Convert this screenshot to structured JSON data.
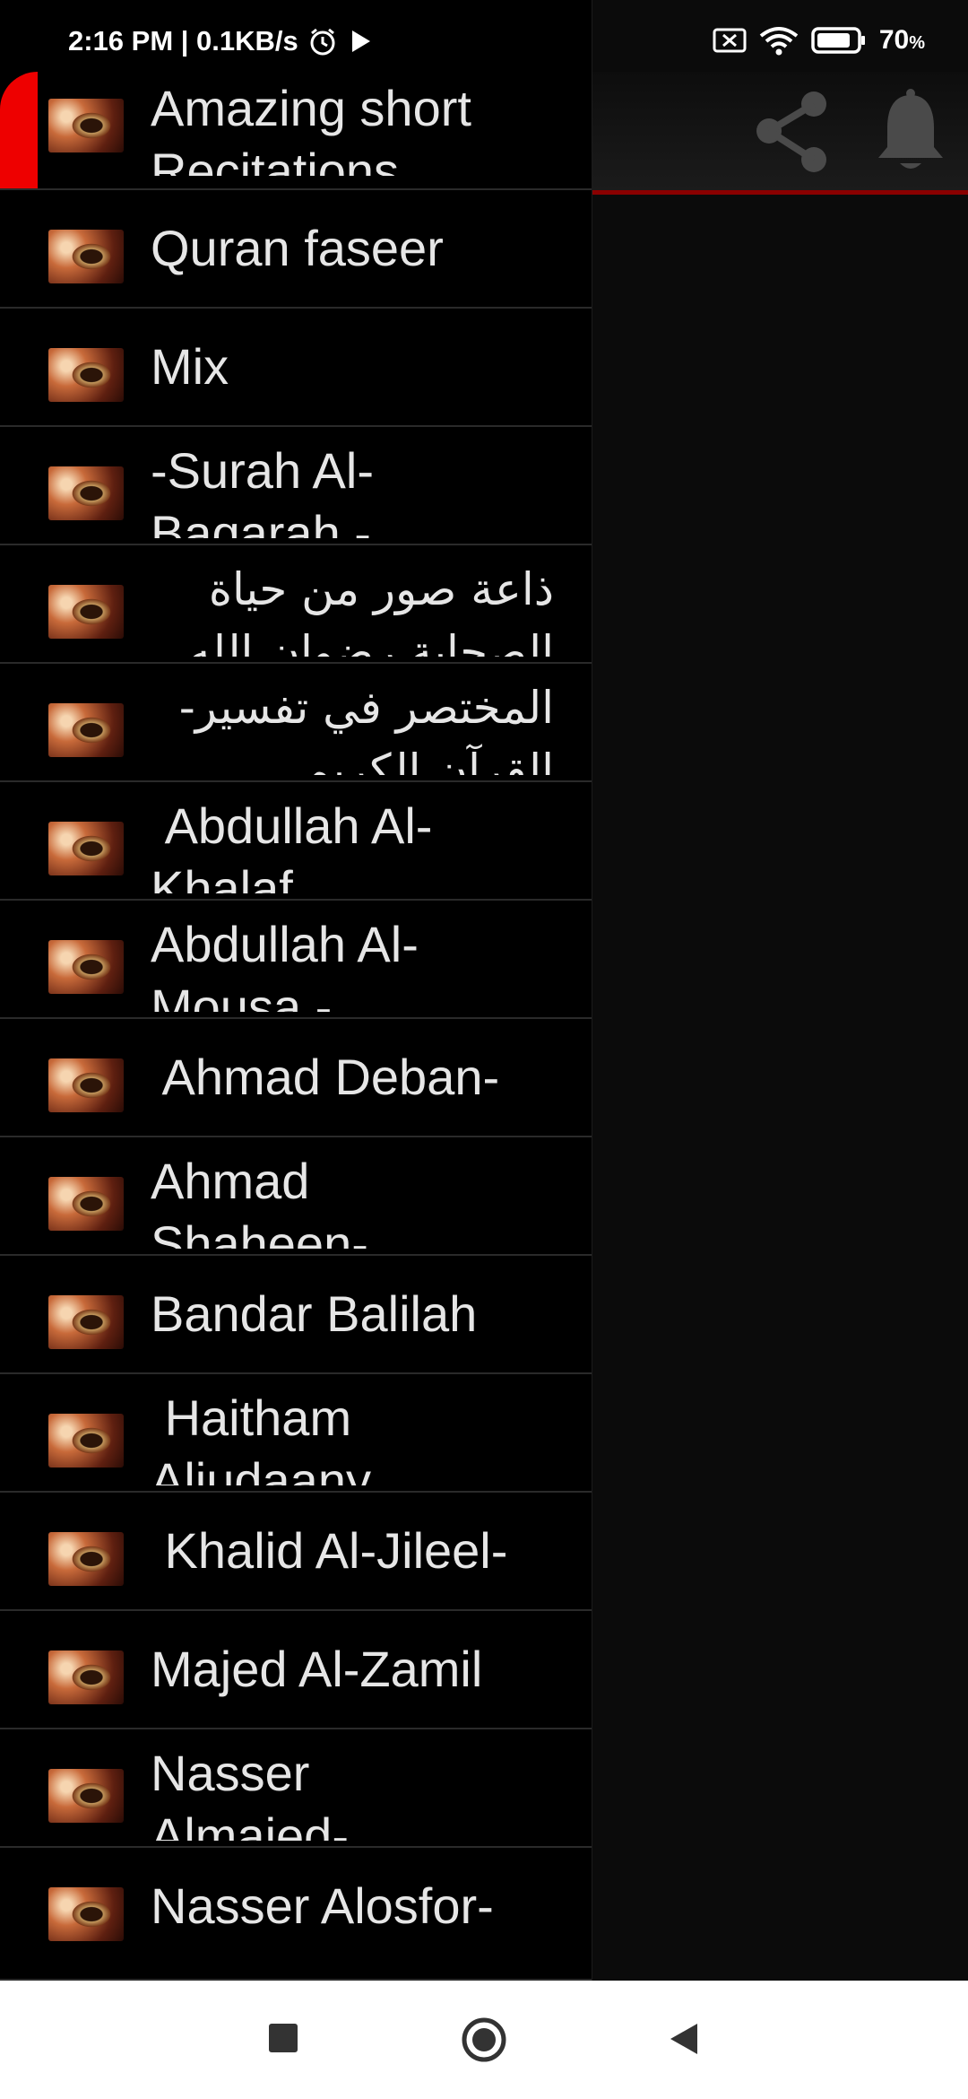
{
  "status_bar": {
    "time": "2:16 PM | 0.1KB/s",
    "battery": "70",
    "battery_unit": "%"
  },
  "toolbar": {
    "share_icon": "share-icon",
    "bell_icon": "bell-icon"
  },
  "drawer": {
    "items": [
      {
        "label": "Amazing short Recitations"
      },
      {
        "label": "Quran faseer"
      },
      {
        "label": "Mix"
      },
      {
        "label": "-Surah Al-Baqarah -"
      },
      {
        "label": "ذاعة صور من حياة الصحابة رضوان الله"
      },
      {
        "label": "المختصر في تفسير- القرآن الكريم"
      },
      {
        "label": " Abdullah Al-Khalaf"
      },
      {
        "label": "Abdullah Al-Mousa -"
      },
      {
        "label": " Ahmad Deban-"
      },
      {
        "label": "Ahmad Shaheen-"
      },
      {
        "label": "Bandar Balilah"
      },
      {
        "label": " Haitham Aljudaany"
      },
      {
        "label": " Khalid Al-Jileel-"
      },
      {
        "label": "Majed Al-Zamil"
      },
      {
        "label": "Nasser Almajed-"
      },
      {
        "label": "Nasser Alosfor-"
      }
    ]
  },
  "nav_bar": {
    "recents": "square-icon",
    "home": "circle-icon",
    "back": "triangle-icon"
  }
}
